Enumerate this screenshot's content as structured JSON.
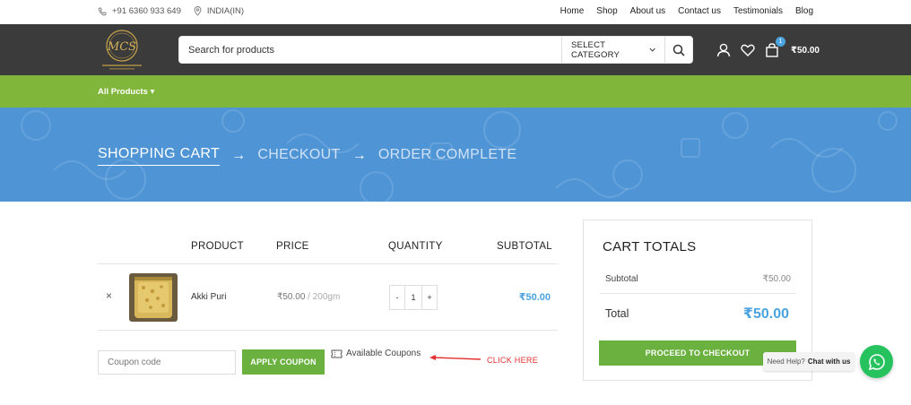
{
  "topbar": {
    "phone": "+91 6360 933 649",
    "country": "INDIA(IN)",
    "nav": [
      "Home",
      "Shop",
      "About us",
      "Contact us",
      "Testimonials",
      "Blog"
    ]
  },
  "header": {
    "logo_text": "MCS",
    "search_placeholder": "Search for products",
    "category_label": "SELECT CATEGORY",
    "cart_count": "1",
    "cart_total": "₹50.00"
  },
  "catbar": {
    "all_products": "All Products ▾"
  },
  "banner": {
    "steps": [
      "SHOPPING CART",
      "CHECKOUT",
      "ORDER COMPLETE"
    ],
    "arrow": "→"
  },
  "cart": {
    "headers": {
      "product": "PRODUCT",
      "price": "PRICE",
      "quantity": "QUANTITY",
      "subtotal": "SUBTOTAL"
    },
    "items": [
      {
        "remove": "×",
        "name": "Akki Puri",
        "price": "₹50.00",
        "unit": " / 200gm",
        "qty_minus": "-",
        "qty": "1",
        "qty_plus": "+",
        "subtotal": "₹50.00"
      }
    ],
    "coupon_placeholder": "Coupon code",
    "apply_label": "APPLY COUPON",
    "available_coupons": "Available Coupons",
    "click_here": "CLICK HERE"
  },
  "totals": {
    "title": "CART TOTALS",
    "subtotal_label": "Subtotal",
    "subtotal_value": "₹50.00",
    "total_label": "Total",
    "total_value": "₹50.00",
    "checkout_label": "PROCEED TO CHECKOUT"
  },
  "whatsapp": {
    "need_help": "Need Help?",
    "chat": "Chat with us"
  },
  "colors": {
    "accent_green": "#80b73a",
    "button_green": "#6ab13f",
    "banner_blue": "#4f95d6",
    "price_blue": "#4aa3df",
    "header_dark": "#3b3b3b"
  }
}
